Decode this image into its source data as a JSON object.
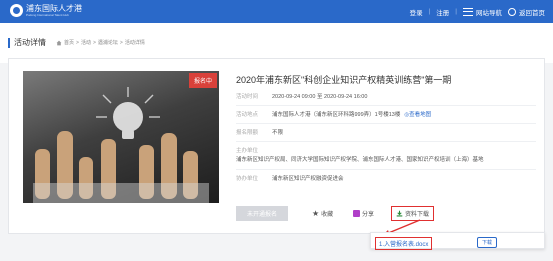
{
  "header": {
    "logo_text": "浦东国际人才港",
    "logo_sub": "Pudong International Talent Hub",
    "login": "登录",
    "separator": "|",
    "register": "注册",
    "site_nav": "网站导航",
    "back_home": "返回首页"
  },
  "page": {
    "title": "活动详情",
    "breadcrumb": [
      "首页",
      "活动",
      "遇浦论坛",
      "活动详情"
    ],
    "breadcrumb_sep": ">"
  },
  "event": {
    "badge": "报名中",
    "title": "2020年浦东新区\"科创企业知识产权精英训练营\"第一期",
    "time_label": "活动时间",
    "time_value": "2020-09-24 09:00 至 2020-09-24 16:00",
    "location_label": "活动地点",
    "location_value": "浦东国际人才港（浦东新区环科路999弄）1号楼13楼",
    "map_link": "查看地图",
    "limit_label": "报名限额",
    "limit_value": "不限",
    "organizer_label": "主办单位",
    "organizer_value": "浦东新区知识产权局、同济大学国际知识产权学院、浦东国际人才港、国家知识产权培训（上海）基地",
    "co_label": "协办单位",
    "co_value": "浦东新区知识产权融资促进会"
  },
  "actions": {
    "signup": "未开通报名",
    "favorite": "收藏",
    "share": "分享",
    "download": "资料下载"
  },
  "popup": {
    "file_name": "1.入营报名表.docx",
    "download": "下载"
  },
  "colors": {
    "brand": "#2a69c9",
    "badge": "#d9413a",
    "highlight": "#e03030"
  }
}
